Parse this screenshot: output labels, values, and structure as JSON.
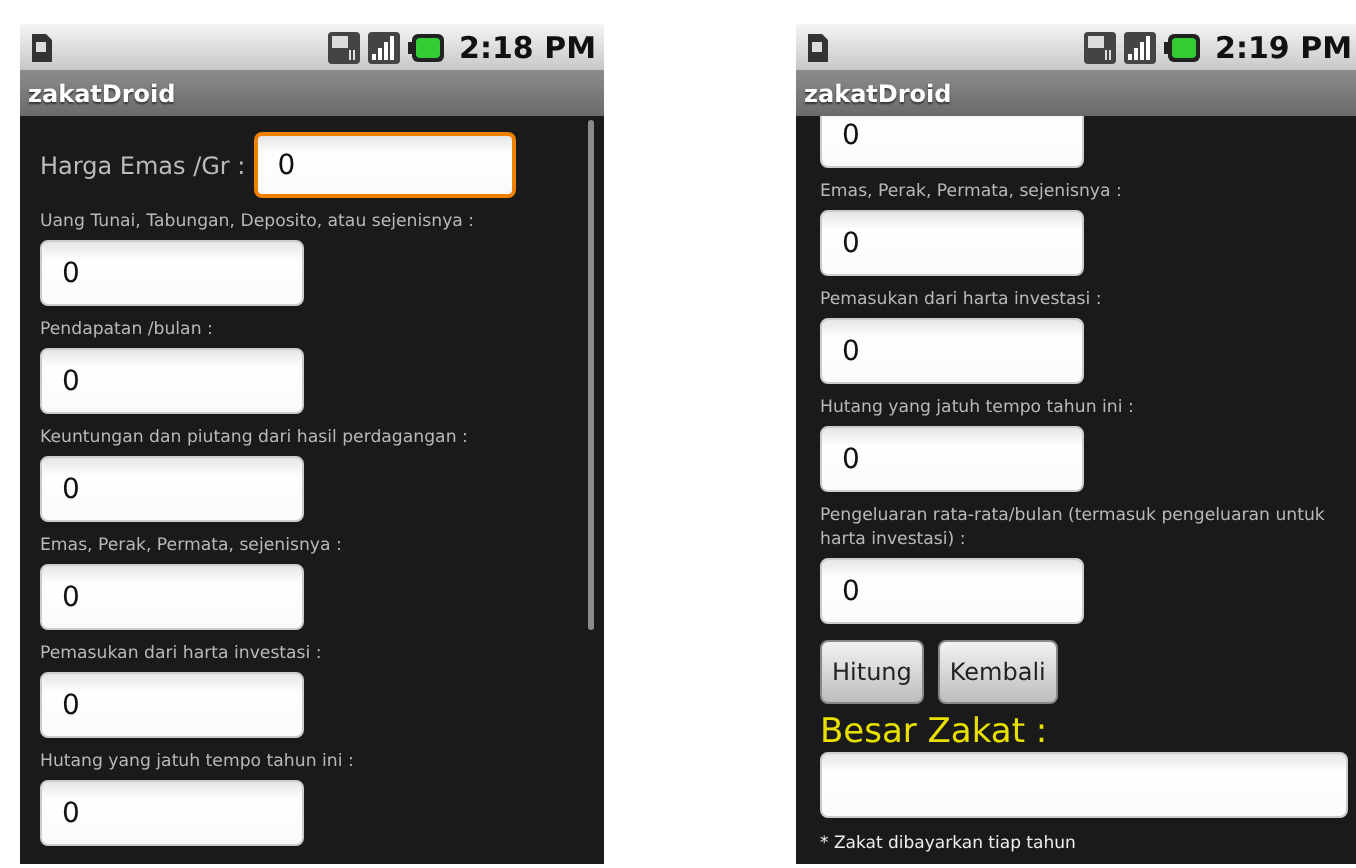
{
  "screens": [
    {
      "status_bar": {
        "time": "2:18 PM"
      },
      "app_title": "zakatDroid",
      "gold_price": {
        "label": "Harga Emas /Gr :",
        "value": "0",
        "focused": true
      },
      "form": [
        {
          "label": "Uang Tunai, Tabungan, Deposito, atau sejenisnya :",
          "value": "0",
          "focused": false
        },
        {
          "label": "Pendapatan /bulan :",
          "value": "0",
          "focused": false
        },
        {
          "label": "Keuntungan dan piutang dari hasil perdagangan :",
          "value": "0",
          "focused": false
        },
        {
          "label": "Emas, Perak, Permata, sejenisnya :",
          "value": "0",
          "focused": false
        },
        {
          "label": "Pemasukan dari harta investasi :",
          "value": "0",
          "focused": false
        },
        {
          "label": "Hutang yang jatuh tempo tahun ini :",
          "value": "0",
          "focused": false
        }
      ]
    },
    {
      "status_bar": {
        "time": "2:19 PM"
      },
      "app_title": "zakatDroid",
      "form": [
        {
          "value": "0",
          "focused": false
        },
        {
          "label": "Emas, Perak, Permata, sejenisnya :",
          "value": "0",
          "focused": false
        },
        {
          "label": "Pemasukan dari harta investasi :",
          "value": "0",
          "focused": false
        },
        {
          "label": "Hutang yang jatuh tempo tahun ini :",
          "value": "0",
          "focused": false
        },
        {
          "label": "Pengeluaran rata-rata/bulan (termasuk pengeluaran untuk harta investasi) :",
          "value": "0",
          "focused": false
        }
      ],
      "buttons": [
        "Hitung",
        "Kembali"
      ],
      "result": {
        "label": "Besar Zakat :"
      },
      "note": "* Zakat dibayarkan tiap tahun"
    }
  ]
}
